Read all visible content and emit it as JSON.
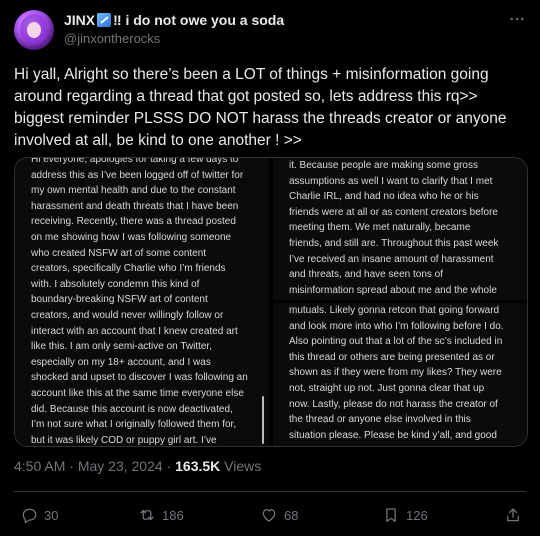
{
  "author": {
    "name_prefix": "JINX",
    "name_suffix": "‼ i do not owe you a soda",
    "name_emoji": "comet-emoji",
    "handle": "@jinxontherocks"
  },
  "tweet": {
    "text": "Hi yall, Alright so there’s been a LOT of things + misinformation going around regarding a thread that got posted so, lets address this rq>> biggest reminder PLSSS DO NOT harass the threads creator or anyone involved at all, be kind to one another ! >>"
  },
  "media": {
    "left_panel_text": "Hi everyone, apologies for taking a few days to\naddress this as I’ve been logged off of twitter for\nmy own mental health and due to the constant\nharassment and death threats that I have been\nreceiving. Recently, there was a thread posted\non me showing how I was following someone\nwho created NSFW art of some content\ncreators, specifically Charlie who I’m friends\nwith. I absolutely condemn this kind of\nboundary-breaking NSFW art of content\ncreators, and would never willingly follow or\ninteract with an account that I knew created art\nlike this. I am only semi-active on Twitter,\nespecially on my 18+ account, and I was\nshocked and upset to discover I was following an\naccount like this at the same time everyone else\ndid. Because this account is now deactivated,\nI’m not sure what I originally followed them for,\nbut it was likely COD or puppy girl art. I’ve",
    "right_top_text": "it. Because people are making some gross\nassumptions as well I want to clarify that I met\nCharlie IRL, and had no idea who he or his\nfriends were at all or as content creators before\nmeeting them. We met naturally, became\nfriends, and still are. Throughout this past week\nI’ve received an insane amount of harassment\nand threats, and have seen tons of\nmisinformation spread about me and the whole\nsituation so I definitely felt a need to clarify",
    "right_bottom_text": "mutuals. Likely gonna retcon that going forward\nand look more into who I’m following before I do.\nAlso pointing out that a lot of the sc’s included in\nthis thread or others are being presented as or\nshown as if they were from my likes? They were\nnot, straight up not. Just gonna clear that up\nnow. Lastly, please do not harass the creator of\nthe thread or anyone else involved in this\nsituation please. Please be kind y’all, and good"
  },
  "meta": {
    "time": "4:50 AM",
    "sep1": " · ",
    "date": "May 23, 2024",
    "sep2": " · ",
    "views_count": "163.5K",
    "views_label": " Views"
  },
  "actions": {
    "replies": "30",
    "reposts": "186",
    "likes": "68",
    "bookmarks": "126"
  },
  "icons": {
    "more": "more-icon",
    "reply": "reply-icon",
    "repost": "repost-icon",
    "like": "heart-icon",
    "bookmark": "bookmark-icon",
    "share": "share-icon"
  }
}
